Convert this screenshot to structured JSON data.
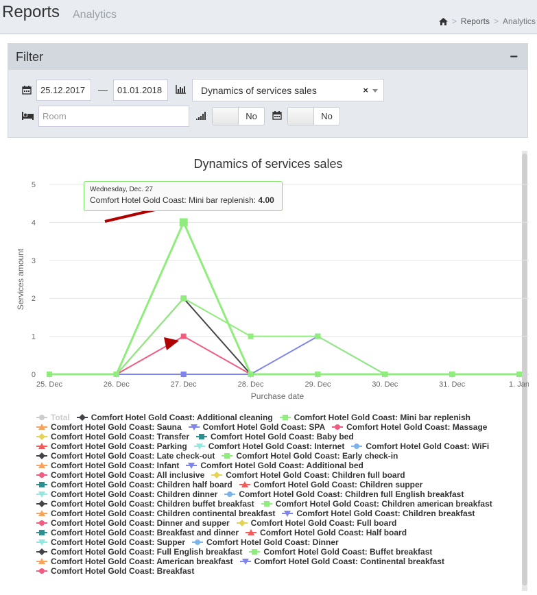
{
  "header": {
    "title": "Reports",
    "subtitle": "Analytics"
  },
  "breadcrumb": {
    "items": [
      "Reports",
      "Analytics"
    ]
  },
  "filter": {
    "title": "Filter",
    "collapse_label": "−",
    "date_from": "25.12.2017",
    "date_dash": "—",
    "date_to": "01.01.2018",
    "report_type": "Dynamics of services sales",
    "clear_label": "×",
    "room_placeholder": "Room",
    "toggle1_label": "No",
    "toggle2_label": "No"
  },
  "tooltip": {
    "date": "Wednesday, Dec. 27",
    "series": "Comfort Hotel Gold Coast: Mini bar replenish",
    "value": "4.00"
  },
  "chart_data": {
    "type": "line",
    "title": "Dynamics of services sales",
    "xlabel": "Purchase date",
    "ylabel": "Services amount",
    "categories": [
      "25. Dec",
      "26. Dec",
      "27. Dec",
      "28. Dec",
      "29. Dec",
      "30. Dec",
      "31. Dec",
      "1. Jan"
    ],
    "ylim": [
      0,
      5
    ],
    "yticks": [
      0,
      1,
      2,
      3,
      4,
      5
    ],
    "grid": true,
    "legend_position": "bottom",
    "series": [
      {
        "name": "Comfort Hotel Gold Coast: Mini bar replenish",
        "color": "#90ed7d",
        "values": [
          0,
          0,
          4,
          0,
          0,
          0,
          0,
          0
        ]
      },
      {
        "name": "Comfort Hotel Gold Coast: Early check-in",
        "color": "#90ed7d",
        "values": [
          0,
          0,
          2,
          1,
          1,
          0,
          0,
          0
        ]
      },
      {
        "name": "Comfort Hotel Gold Coast: Additional cleaning",
        "color": "#434348",
        "values": [
          0,
          0,
          2,
          0,
          0,
          0,
          0,
          0
        ]
      },
      {
        "name": "Comfort Hotel Gold Coast: SPA",
        "color": "#8085e9",
        "values": [
          0,
          0,
          0,
          0,
          1,
          0,
          0,
          0
        ]
      },
      {
        "name": "Comfort Hotel Gold Coast: Massage",
        "color": "#f15c80",
        "values": [
          0,
          0,
          1,
          0,
          0,
          0,
          0,
          0
        ]
      },
      {
        "name": "Comfort Hotel Gold Coast: Breakfast",
        "color": "#f15c80",
        "values": [
          0,
          0,
          0,
          0,
          0,
          0,
          0,
          0
        ]
      }
    ],
    "legend": [
      {
        "name": "Total",
        "color": "#cccccc",
        "marker": "circle",
        "hidden": true
      },
      {
        "name": "Comfort Hotel Gold Coast: Additional cleaning",
        "color": "#434348",
        "marker": "diamond"
      },
      {
        "name": "Comfort Hotel Gold Coast: Mini bar replenish",
        "color": "#90ed7d",
        "marker": "square"
      },
      {
        "name": "Comfort Hotel Gold Coast: Sauna",
        "color": "#f7a35c",
        "marker": "triangle"
      },
      {
        "name": "Comfort Hotel Gold Coast: SPA",
        "color": "#8085e9",
        "marker": "triangle-down"
      },
      {
        "name": "Comfort Hotel Gold Coast: Massage",
        "color": "#f15c80",
        "marker": "circle"
      },
      {
        "name": "Comfort Hotel Gold Coast: Transfer",
        "color": "#e4d354",
        "marker": "diamond"
      },
      {
        "name": "Comfort Hotel Gold Coast: Baby bed",
        "color": "#2b908f",
        "marker": "square"
      },
      {
        "name": "Comfort Hotel Gold Coast: Parking",
        "color": "#f45b5b",
        "marker": "triangle"
      },
      {
        "name": "Comfort Hotel Gold Coast: Internet",
        "color": "#91e8e1",
        "marker": "triangle-down"
      },
      {
        "name": "Comfort Hotel Gold Coast: WiFi",
        "color": "#7cb5ec",
        "marker": "circle"
      },
      {
        "name": "Comfort Hotel Gold Coast: Late check-out",
        "color": "#434348",
        "marker": "diamond"
      },
      {
        "name": "Comfort Hotel Gold Coast: Early check-in",
        "color": "#90ed7d",
        "marker": "square"
      },
      {
        "name": "Comfort Hotel Gold Coast: Infant",
        "color": "#f7a35c",
        "marker": "triangle"
      },
      {
        "name": "Comfort Hotel Gold Coast: Additional bed",
        "color": "#8085e9",
        "marker": "triangle-down"
      },
      {
        "name": "Comfort Hotel Gold Coast: All inclusive",
        "color": "#f15c80",
        "marker": "circle"
      },
      {
        "name": "Comfort Hotel Gold Coast: Children full board",
        "color": "#e4d354",
        "marker": "diamond"
      },
      {
        "name": "Comfort Hotel Gold Coast: Children half board",
        "color": "#2b908f",
        "marker": "square"
      },
      {
        "name": "Comfort Hotel Gold Coast: Children supper",
        "color": "#f45b5b",
        "marker": "triangle"
      },
      {
        "name": "Comfort Hotel Gold Coast: Children dinner",
        "color": "#91e8e1",
        "marker": "triangle-down"
      },
      {
        "name": "Comfort Hotel Gold Coast: Children full English breakfast",
        "color": "#7cb5ec",
        "marker": "circle"
      },
      {
        "name": "Comfort Hotel Gold Coast: Children buffet breakfast",
        "color": "#434348",
        "marker": "diamond"
      },
      {
        "name": "Comfort Hotel Gold Coast: Children american breakfast",
        "color": "#90ed7d",
        "marker": "square"
      },
      {
        "name": "Comfort Hotel Gold Coast: Children continental breakfast",
        "color": "#f7a35c",
        "marker": "triangle"
      },
      {
        "name": "Comfort Hotel Gold Coast: Children breakfast",
        "color": "#8085e9",
        "marker": "triangle-down"
      },
      {
        "name": "Comfort Hotel Gold Coast: Dinner and supper",
        "color": "#f15c80",
        "marker": "circle"
      },
      {
        "name": "Comfort Hotel Gold Coast: Full board",
        "color": "#e4d354",
        "marker": "diamond"
      },
      {
        "name": "Comfort Hotel Gold Coast: Breakfast and dinner",
        "color": "#2b908f",
        "marker": "square"
      },
      {
        "name": "Comfort Hotel Gold Coast: Half board",
        "color": "#f45b5b",
        "marker": "triangle"
      },
      {
        "name": "Comfort Hotel Gold Coast: Supper",
        "color": "#91e8e1",
        "marker": "triangle-down"
      },
      {
        "name": "Comfort Hotel Gold Coast: Dinner",
        "color": "#7cb5ec",
        "marker": "circle"
      },
      {
        "name": "Comfort Hotel Gold Coast: Full English breakfast",
        "color": "#434348",
        "marker": "diamond"
      },
      {
        "name": "Comfort Hotel Gold Coast: Buffet breakfast",
        "color": "#90ed7d",
        "marker": "square"
      },
      {
        "name": "Comfort Hotel Gold Coast: American breakfast",
        "color": "#f7a35c",
        "marker": "triangle"
      },
      {
        "name": "Comfort Hotel Gold Coast: Continental breakfast",
        "color": "#8085e9",
        "marker": "triangle-down"
      },
      {
        "name": "Comfort Hotel Gold Coast: Breakfast",
        "color": "#f15c80",
        "marker": "circle"
      }
    ]
  }
}
